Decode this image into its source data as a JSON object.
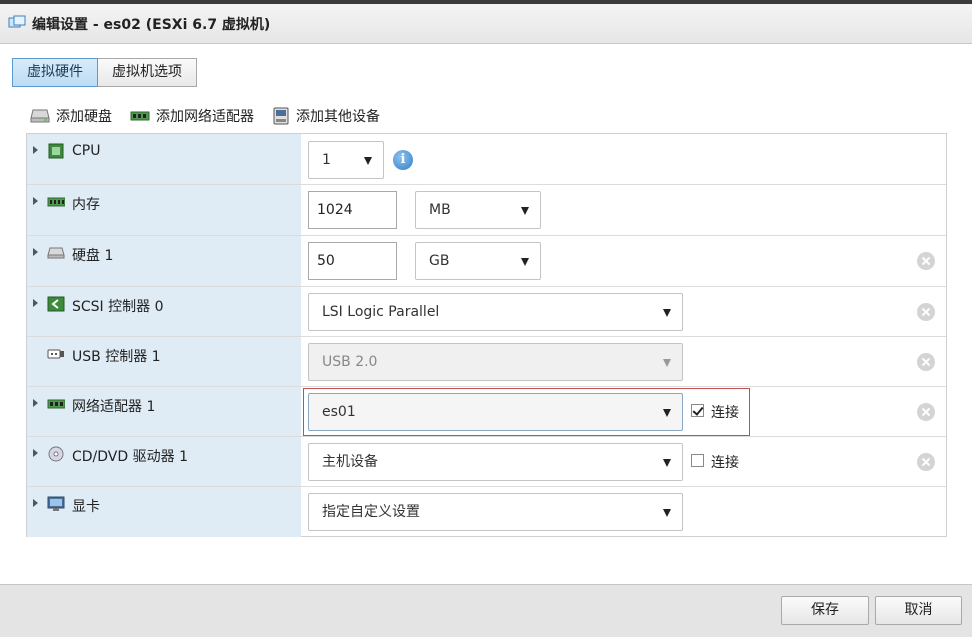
{
  "window": {
    "title": "编辑设置 - es02 (ESXi 6.7 虚拟机)"
  },
  "tabs": [
    {
      "label": "虚拟硬件",
      "active": true
    },
    {
      "label": "虚拟机选项",
      "active": false
    }
  ],
  "toolbar": {
    "add_disk": "添加硬盘",
    "add_nic": "添加网络适配器",
    "add_other": "添加其他设备"
  },
  "hardware": {
    "cpu": {
      "label": "CPU",
      "value": "1"
    },
    "memory": {
      "label": "内存",
      "value": "1024",
      "unit": "MB"
    },
    "disk": {
      "label": "硬盘 1",
      "value": "50",
      "unit": "GB"
    },
    "scsi": {
      "label": "SCSI 控制器 0",
      "value": "LSI Logic Parallel"
    },
    "usb": {
      "label": "USB 控制器 1",
      "value": "USB 2.0"
    },
    "nic": {
      "label": "网络适配器 1",
      "value": "es01",
      "connect_label": "连接",
      "connected": true
    },
    "cdrom": {
      "label": "CD/DVD 驱动器 1",
      "value": "主机设备",
      "connect_label": "连接",
      "connected": false
    },
    "video": {
      "label": "显卡",
      "value": "指定自定义设置"
    }
  },
  "footer": {
    "save_label": "保存",
    "cancel_label": "取消"
  },
  "colors": {
    "accent": "#5d9ad0",
    "label_column": "#dfecf6",
    "highlight": "#c0504d"
  }
}
